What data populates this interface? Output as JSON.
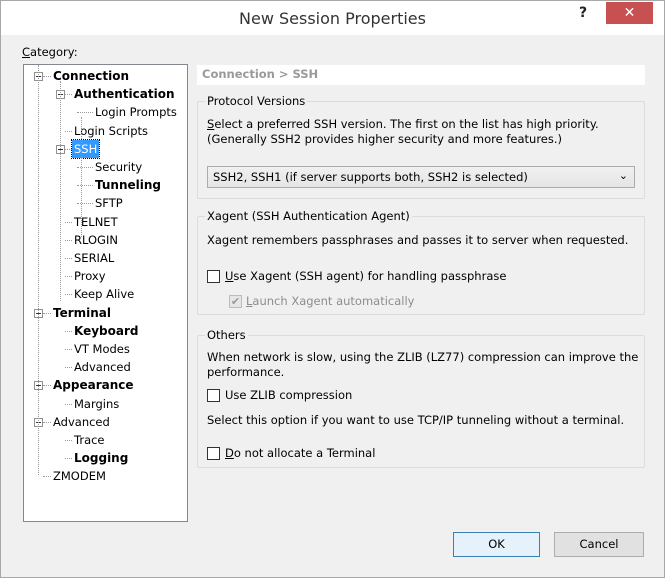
{
  "window": {
    "title": "New Session Properties",
    "help": "?",
    "close": "✕"
  },
  "category_label": "Category:",
  "tree": [
    {
      "label": "Connection",
      "level": 0,
      "bold": true,
      "expanded": true
    },
    {
      "label": "Authentication",
      "level": 1,
      "bold": true,
      "expanded": true
    },
    {
      "label": "Login Prompts",
      "level": 2
    },
    {
      "label": "Login Scripts",
      "level": 1
    },
    {
      "label": "SSH",
      "level": 1,
      "expanded": true,
      "selected": true
    },
    {
      "label": "Security",
      "level": 2
    },
    {
      "label": "Tunneling",
      "level": 2,
      "bold": true
    },
    {
      "label": "SFTP",
      "level": 2
    },
    {
      "label": "TELNET",
      "level": 1
    },
    {
      "label": "RLOGIN",
      "level": 1
    },
    {
      "label": "SERIAL",
      "level": 1
    },
    {
      "label": "Proxy",
      "level": 1
    },
    {
      "label": "Keep Alive",
      "level": 1
    },
    {
      "label": "Terminal",
      "level": 0,
      "bold": true,
      "expanded": true
    },
    {
      "label": "Keyboard",
      "level": 1,
      "bold": true
    },
    {
      "label": "VT Modes",
      "level": 1
    },
    {
      "label": "Advanced",
      "level": 1
    },
    {
      "label": "Appearance",
      "level": 0,
      "bold": true,
      "expanded": true
    },
    {
      "label": "Margins",
      "level": 1
    },
    {
      "label": "Advanced",
      "level": 0,
      "expanded": true
    },
    {
      "label": "Trace",
      "level": 1
    },
    {
      "label": "Logging",
      "level": 1,
      "bold": true
    },
    {
      "label": "ZMODEM",
      "level": 0
    }
  ],
  "breadcrumb": "Connection > SSH",
  "protocol": {
    "title": "Protocol Versions",
    "desc1": "Select a preferred SSH version. The first on the list has high priority.",
    "desc2": "(Generally SSH2 provides higher security and more features.)",
    "selected": "SSH2, SSH1 (if server supports both, SSH2 is selected)"
  },
  "xagent": {
    "title": "Xagent (SSH Authentication Agent)",
    "desc": "Xagent remembers passphrases and passes it to server when requested.",
    "use_label": "Use Xagent (SSH agent) for handling passphrase",
    "use_checked": false,
    "launch_label": "Launch Xagent automatically",
    "launch_checked": true,
    "launch_disabled": true
  },
  "others": {
    "title": "Others",
    "desc1": "When network is slow, using the ZLIB (LZ77) compression can improve the",
    "desc2": "performance.",
    "zlib_label": "Use ZLIB compression",
    "zlib_checked": false,
    "tunnel_desc": "Select this option if you want to use TCP/IP tunneling without a terminal.",
    "noterm_label": "Do not allocate a Terminal",
    "noterm_checked": false
  },
  "buttons": {
    "ok": "OK",
    "cancel": "Cancel"
  }
}
